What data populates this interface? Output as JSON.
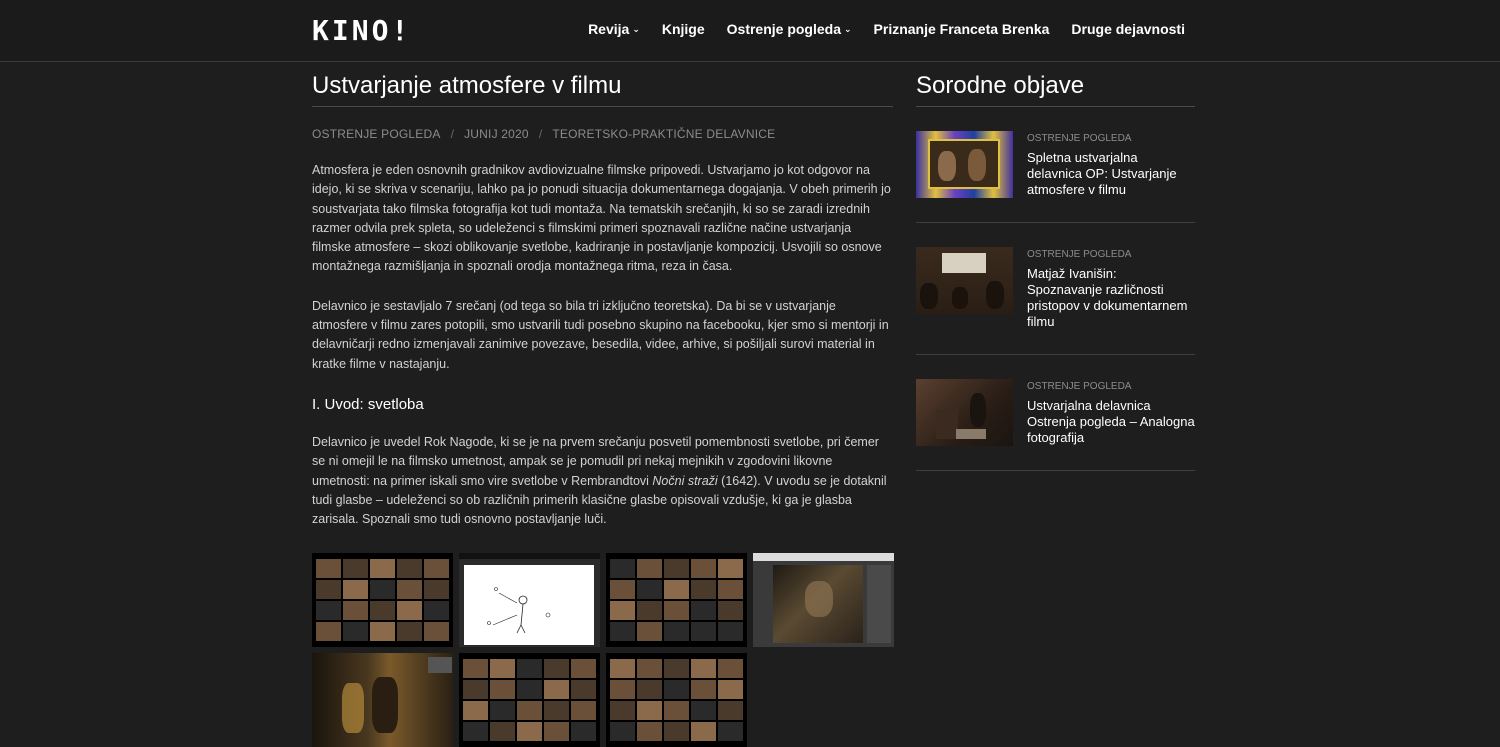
{
  "header": {
    "logo": "KINO!",
    "nav": [
      {
        "label": "Revija",
        "has_dropdown": true
      },
      {
        "label": "Knjige",
        "has_dropdown": false
      },
      {
        "label": "Ostrenje pogleda",
        "has_dropdown": true
      },
      {
        "label": "Priznanje Franceta Brenka",
        "has_dropdown": false
      },
      {
        "label": "Druge dejavnosti",
        "has_dropdown": false
      }
    ],
    "dropdown_icon": "chevron-down-icon"
  },
  "article": {
    "title": "Ustvarjanje atmosfere v filmu",
    "meta": {
      "category": "OSTRENJE POGLEDA",
      "date": "JUNIJ 2020",
      "tag": "TEORETSKO-PRAKTIČNE DELAVNICE",
      "separator": "/"
    },
    "paragraph_1": "Atmosfera je eden osnovnih gradnikov avdiovizualne filmske pripovedi. Ustvarjamo jo kot odgovor na idejo, ki se skriva v scenariju, lahko pa jo ponudi situacija dokumentarnega dogajanja. V obeh primerih jo soustvarjata tako filmska fotografija kot tudi montaža. Na tematskih srečanjih, ki so se zaradi izrednih razmer odvila prek spleta, so udeleženci s filmskimi primeri spoznavali različne načine ustvarjanja filmske atmosfere – skozi oblikovanje svetlobe, kadriranje in postavljanje kompozicij. Usvojili so osnove montažnega razmišljanja in spoznali orodja montažnega ritma, reza in časa.",
    "paragraph_2": "Delavnico je sestavljalo 7 srečanj (od tega so bila tri izključno teoretska). Da bi se v ustvarjanje atmosfere v filmu zares potopili, smo ustvarili tudi posebno skupino na facebooku, kjer smo si mentorji in delavničarji redno izmenjavali zanimive povezave, besedila, videe, arhive, si pošiljali surovi material in kratke filme v nastajanju.",
    "section_heading": "I. Uvod: svetloba",
    "paragraph_3_before": "Delavnico je uvedel Rok Nagode, ki se je na prvem srečanju posvetil pomembnosti svetlobe, pri čemer se ni omejil le na filmsko umetnost, ampak se je pomudil pri nekaj mejnikih v zgodovini likovne umetnosti: na primer iskali smo vire svetlobe v Rembrandtovi ",
    "paragraph_3_italic": "Nočni straži",
    "paragraph_3_after": " (1642). V uvodu se je dotaknil tudi glasbe – udeleženci so ob različnih primerih klasične glasbe opisovali vzdušje, ki ga je glasba zarisala. Spoznali smo tudi osnovno postavljanje luči.",
    "gallery_count": 7
  },
  "sidebar": {
    "title": "Sorodne objave",
    "related": [
      {
        "category": "OSTRENJE POGLEDA",
        "title": "Spletna ustvarjalna delavnica OP: Ustvarjanje atmosfere v filmu"
      },
      {
        "category": "OSTRENJE POGLEDA",
        "title": "Matjaž Ivanišin: Spoznavanje različnosti pristopov v dokumentarnem filmu"
      },
      {
        "category": "OSTRENJE POGLEDA",
        "title": "Ustvarjalna delavnica Ostrenja pogleda – Analogna fotografija"
      }
    ]
  },
  "colors": {
    "background": "#1e1e1e",
    "header_bg": "#1b1b1b",
    "text": "#d2d2d2",
    "meta": "#8c8c8c",
    "white": "#ffffff"
  }
}
